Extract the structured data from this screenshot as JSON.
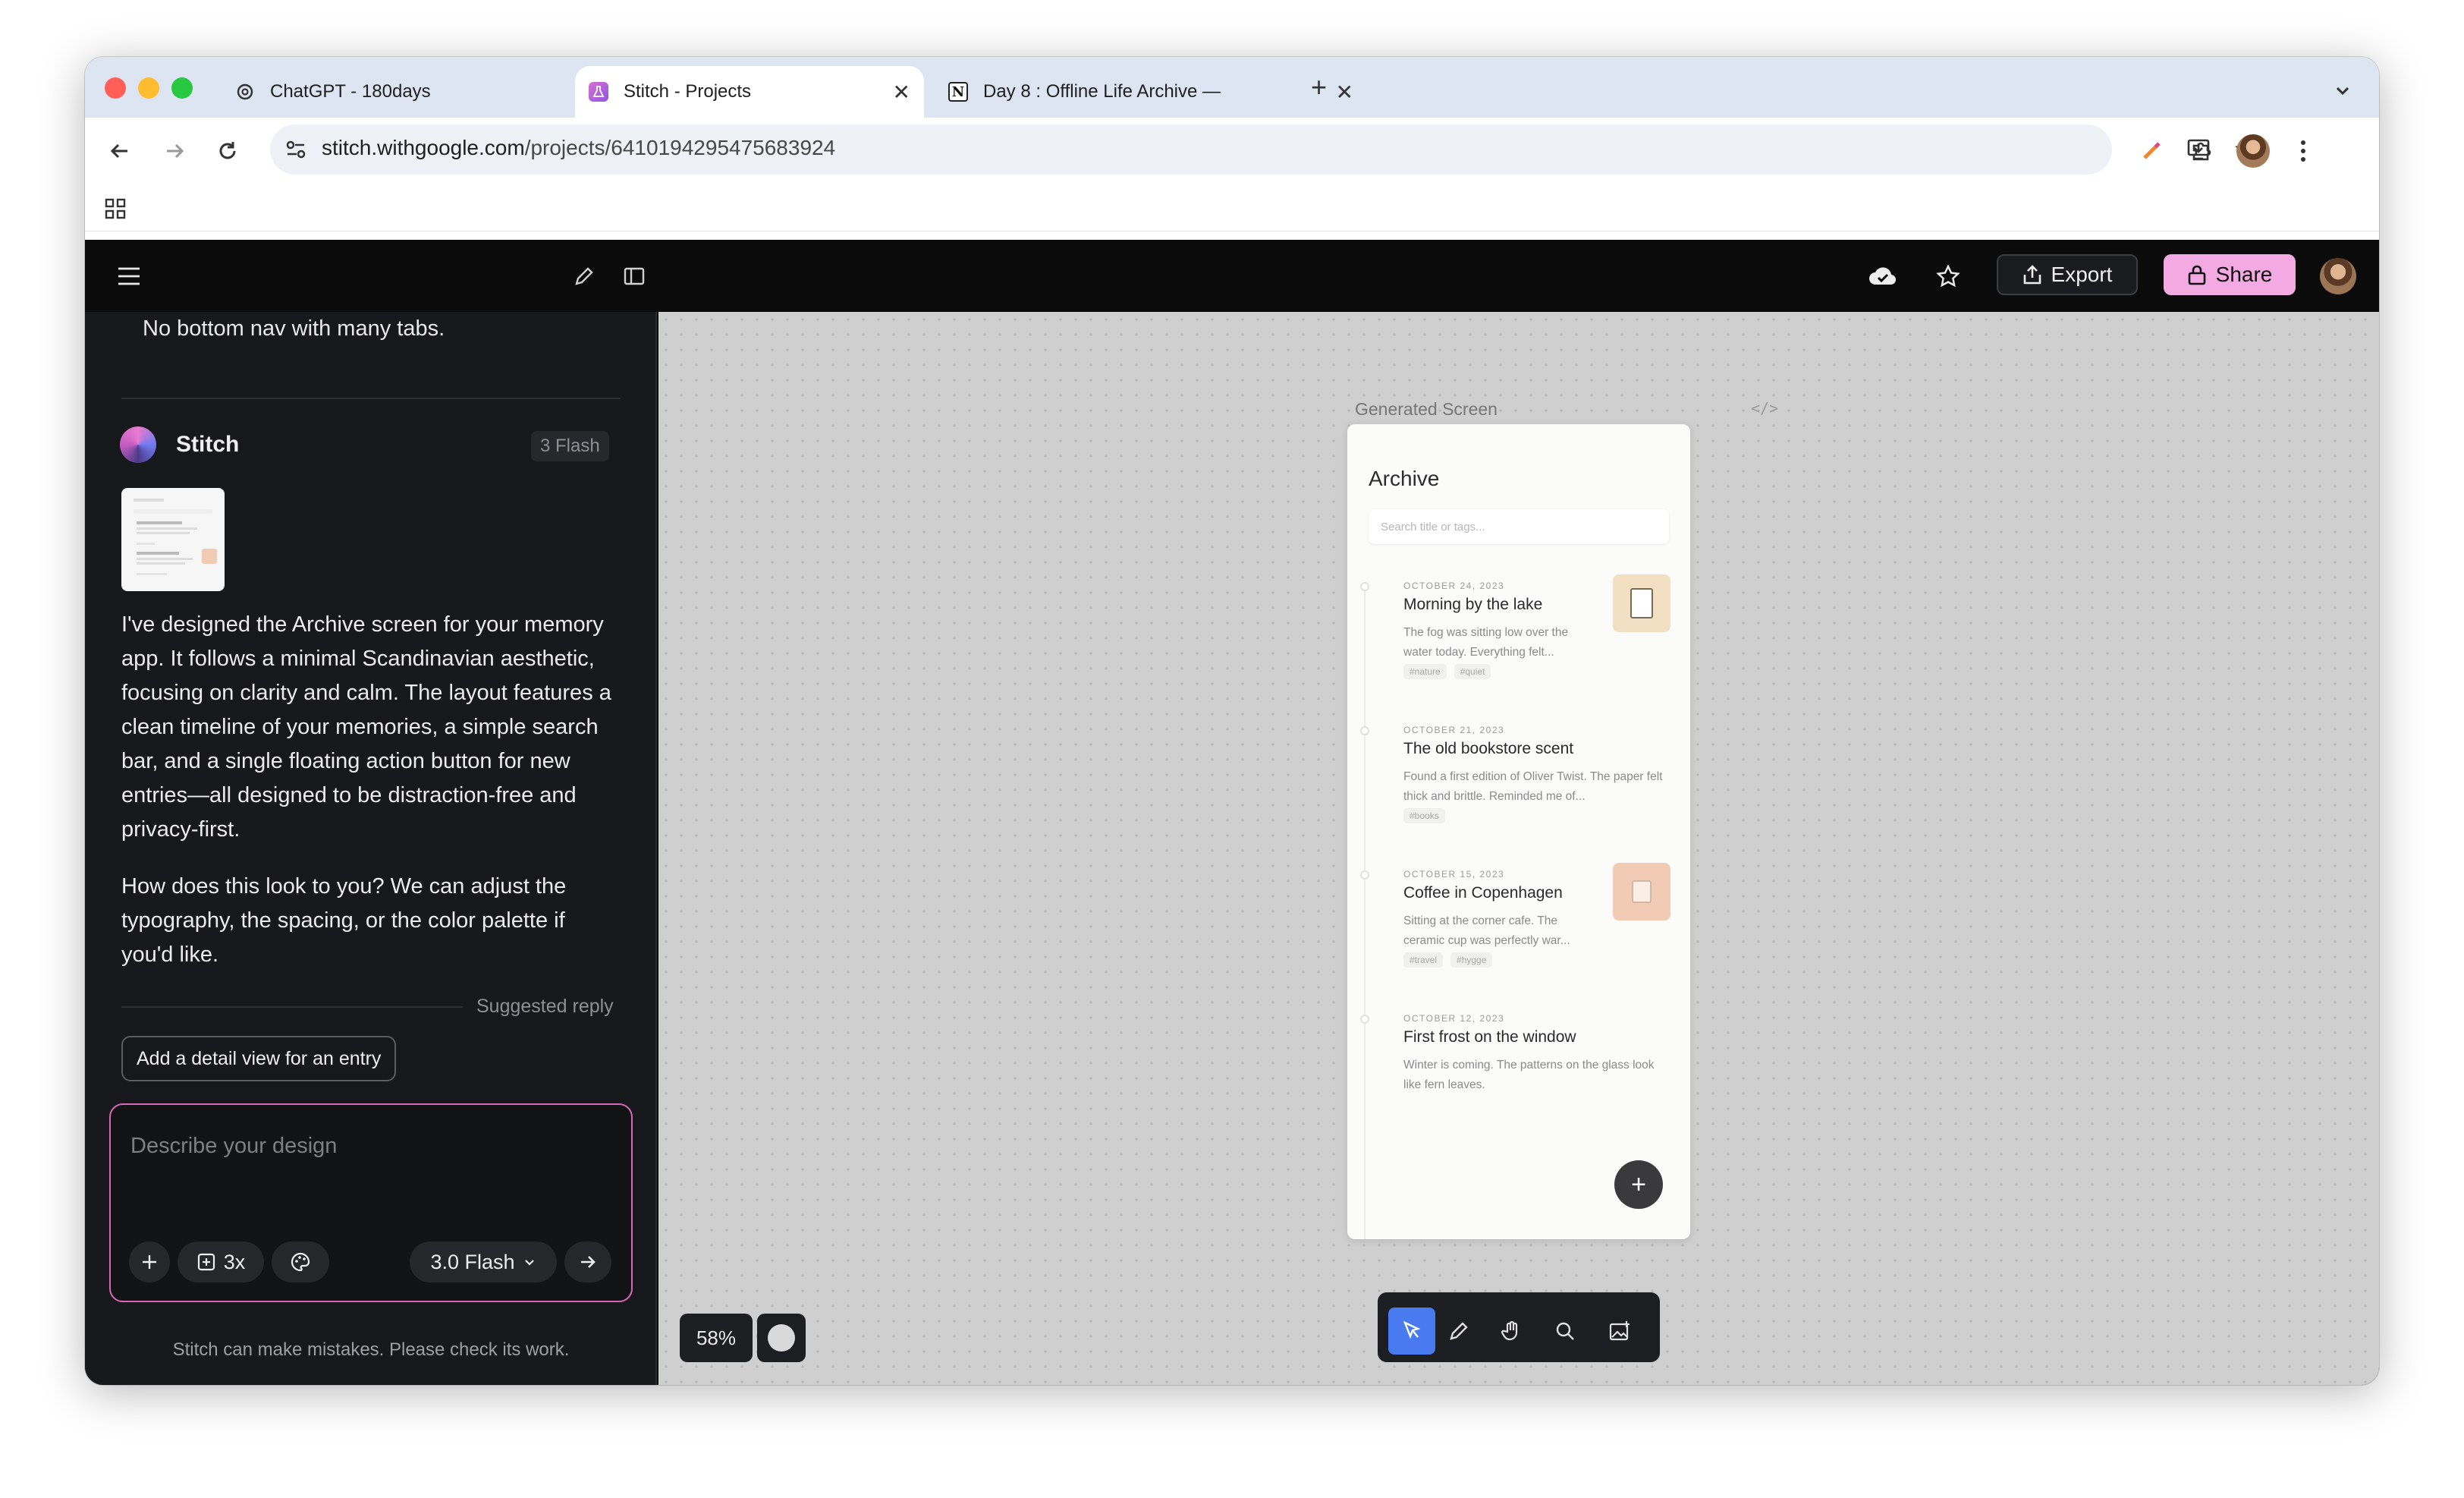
{
  "browser": {
    "tabs": [
      {
        "title": "ChatGPT - 180days",
        "icon": "chatgpt-icon",
        "active": false
      },
      {
        "title": "Stitch - Projects",
        "icon": "stitch-flask-icon",
        "active": true
      },
      {
        "title": "Day 8 : Offline Life Archive —",
        "icon": "notion-icon",
        "active": false
      }
    ],
    "url_host": "stitch.withgoogle.com",
    "url_path": "/projects/6410194295475683924",
    "traffic_lights": {
      "close": "#ff5f57",
      "minimize": "#febc2e",
      "zoom": "#28c840"
    }
  },
  "app": {
    "export_label": "Export",
    "share_label": "Share",
    "share_color": "#f3a9e2",
    "prompt_accent": "#d867b8"
  },
  "chat": {
    "previous_message_tail": "No bottom nav with many tabs.",
    "assistant_name": "Stitch",
    "model_badge": "3 Flash",
    "reply_paragraph_1": "I've designed the Archive screen for your memory app. It follows a minimal Scandinavian aesthetic, focusing on clarity and calm. The layout features a clean timeline of your memories, a simple search bar, and a single floating action button for new entries—all designed to be distraction-free and privacy-first.",
    "reply_paragraph_2": "How does this look to you? We can adjust the typography, the spacing, or the color palette if you'd like.",
    "suggested_reply_label": "Suggested reply",
    "suggested_reply": "Add a detail view for an entry",
    "input_placeholder": "Describe your design",
    "multiplier_label": "3x",
    "model_select": "3.0 Flash",
    "disclaimer": "Stitch can make mistakes. Please check its work."
  },
  "canvas": {
    "frame_label": "Generated Screen",
    "zoom": "58%",
    "preview": {
      "title": "Archive",
      "search_placeholder": "Search title or tags...",
      "entries": [
        {
          "date": "OCTOBER 24, 2023",
          "title": "Morning by the lake",
          "body": "The fog was sitting low over the water today. Everything felt...",
          "tags": [
            "#nature",
            "#quiet"
          ],
          "thumb_color": "#f3e0c2"
        },
        {
          "date": "OCTOBER 21, 2023",
          "title": "The old bookstore scent",
          "body": "Found a first edition of Oliver Twist. The paper felt thick and brittle. Reminded me of...",
          "tags": [
            "#books"
          ]
        },
        {
          "date": "OCTOBER 15, 2023",
          "title": "Coffee in Copenhagen",
          "body": "Sitting at the corner cafe. The ceramic cup was perfectly war...",
          "tags": [
            "#travel",
            "#hygge"
          ],
          "thumb_color": "#f1cbb4"
        },
        {
          "date": "OCTOBER 12, 2023",
          "title": "First frost on the window",
          "body": "Winter is coming. The patterns on the glass look like fern leaves.",
          "tags": []
        }
      ]
    }
  }
}
